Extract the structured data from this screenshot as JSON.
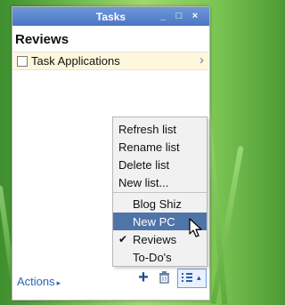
{
  "window": {
    "title": "Tasks",
    "minimize_label": "_",
    "maximize_label": "□",
    "close_label": "×"
  },
  "list": {
    "title": "Reviews",
    "items": [
      {
        "label": "Task Applications"
      }
    ]
  },
  "menu": {
    "actions": [
      "Refresh list",
      "Rename list",
      "Delete list",
      "New list..."
    ],
    "lists": [
      "Blog Shiz",
      "New PC",
      "Reviews",
      "To-Do's"
    ],
    "selected": "Reviews",
    "highlighted": "New PC"
  },
  "footer": {
    "actions_label": "Actions",
    "actions_arrow": "▸",
    "add_label": "+",
    "list_menu_arrow": "▴"
  },
  "icons": {
    "row_chevron": "chevron-right-icon",
    "trash": "trash-icon",
    "list": "list-icon",
    "cursor": "pointer-icon"
  },
  "colors": {
    "titlebar": "#4a76c4",
    "link": "#2f63b3",
    "highlight": "#4f74a8",
    "task_row": "#fff7dc"
  }
}
